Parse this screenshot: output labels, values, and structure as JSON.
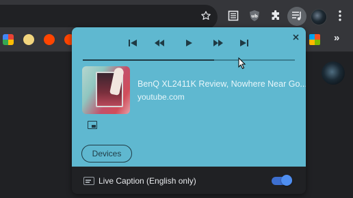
{
  "toolbar": {
    "icons": [
      "star-icon",
      "reading-list-icon",
      "ublock-icon",
      "extensions-icon",
      "media-controls-icon",
      "profile-avatar",
      "more-menu-icon"
    ]
  },
  "bookmarks": {
    "more_label": "»"
  },
  "media_popup": {
    "close_label": "×",
    "controls": [
      "previous-track",
      "seek-backward",
      "play",
      "seek-forward",
      "next-track"
    ],
    "progress": 0.62,
    "track_title": "BenQ XL2411K Review, Nowhere Near Go...",
    "track_source": "youtube.com",
    "devices_label": "Devices",
    "live_caption_label": "Live Caption (English only)",
    "live_caption_enabled": true,
    "background_color": "#5fb8d0"
  }
}
